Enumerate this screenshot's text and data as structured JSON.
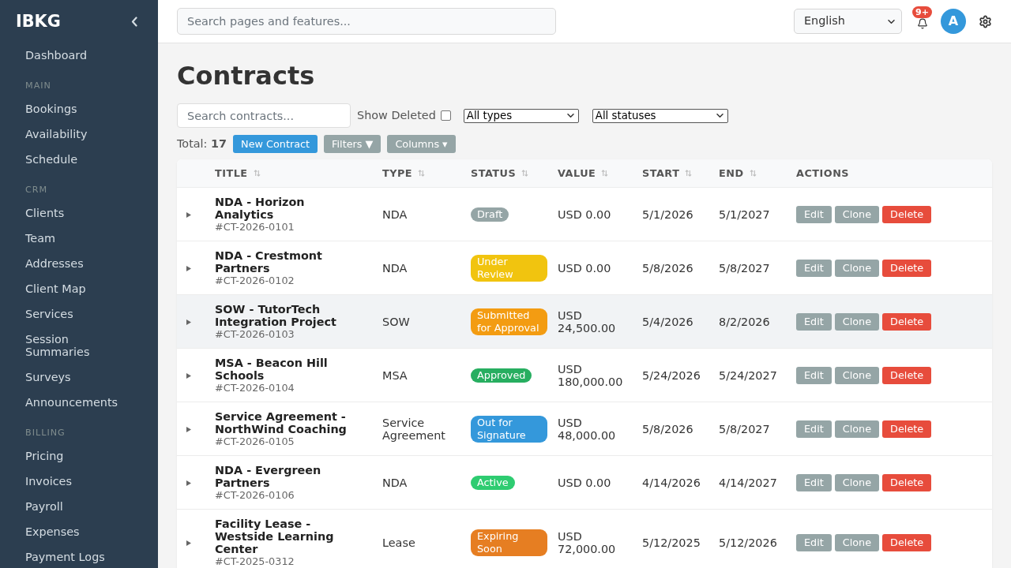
{
  "sidebar": {
    "brand": "IBKG",
    "sections": [
      {
        "items": [
          {
            "label": "Dashboard"
          }
        ]
      },
      {
        "heading": "MAIN",
        "items": [
          {
            "label": "Bookings"
          },
          {
            "label": "Availability"
          },
          {
            "label": "Schedule"
          }
        ]
      },
      {
        "heading": "CRM",
        "items": [
          {
            "label": "Clients"
          },
          {
            "label": "Team"
          },
          {
            "label": "Addresses"
          },
          {
            "label": "Client Map"
          },
          {
            "label": "Services"
          },
          {
            "label": "Session Summaries"
          },
          {
            "label": "Surveys"
          },
          {
            "label": "Announcements"
          }
        ]
      },
      {
        "heading": "BILLING",
        "items": [
          {
            "label": "Pricing"
          },
          {
            "label": "Invoices"
          },
          {
            "label": "Payroll"
          },
          {
            "label": "Expenses"
          },
          {
            "label": "Payment Logs"
          }
        ]
      }
    ]
  },
  "topbar": {
    "search": {
      "placeholder": "Search pages and features..."
    },
    "language": {
      "value": "English"
    },
    "notifications": {
      "badge": "9+"
    },
    "avatar": {
      "initial": "A"
    }
  },
  "page": {
    "title": "Contracts"
  },
  "filters": {
    "search": {
      "placeholder": "Search contracts..."
    },
    "show_deleted": {
      "label": "Show Deleted",
      "checked": false
    },
    "type_select": {
      "value": "All types"
    },
    "status_select": {
      "value": "All statuses"
    }
  },
  "toolbar": {
    "total": "Total: **17**",
    "buttons": [
      {
        "label": "New Contract",
        "kind": "primary"
      },
      {
        "label": "Filters ▼",
        "kind": "secondary"
      },
      {
        "label": "Columns ▾",
        "kind": "secondary"
      }
    ]
  },
  "table": {
    "columns": [
      {
        "label": "TITLE",
        "sortable": true
      },
      {
        "label": "TYPE",
        "sortable": true
      },
      {
        "label": "STATUS",
        "sortable": true
      },
      {
        "label": "VALUE",
        "sortable": true
      },
      {
        "label": "START",
        "sortable": true
      },
      {
        "label": "END",
        "sortable": true
      },
      {
        "label": "ACTIONS",
        "sortable": false
      }
    ],
    "rows": [
      {
        "title": "NDA - Horizon Analytics",
        "id": "#CT-2026-0101",
        "type": "NDA",
        "status": {
          "label": "Draft",
          "color": "#95a5a6"
        },
        "value": "USD 0.00",
        "start": "5/1/2026",
        "end": "5/1/2027",
        "highlighted": false,
        "actions": [
          {
            "label": "Edit",
            "kind": "secondary"
          },
          {
            "label": "Clone",
            "kind": "secondary"
          },
          {
            "label": "Delete",
            "kind": "danger"
          }
        ]
      },
      {
        "title": "NDA - Crestmont Partners",
        "id": "#CT-2026-0102",
        "type": "NDA",
        "status": {
          "label": "Under Review",
          "color": "#f1c40f"
        },
        "value": "USD 0.00",
        "start": "5/8/2026",
        "end": "5/8/2027",
        "highlighted": false,
        "actions": [
          {
            "label": "Edit",
            "kind": "secondary"
          },
          {
            "label": "Clone",
            "kind": "secondary"
          },
          {
            "label": "Delete",
            "kind": "danger"
          }
        ]
      },
      {
        "title": "SOW - TutorTech Integration Project",
        "id": "#CT-2026-0103",
        "type": "SOW",
        "status": {
          "label": "Submitted for Approval",
          "color": "#f39c12"
        },
        "value": "USD 24,500.00",
        "start": "5/4/2026",
        "end": "8/2/2026",
        "highlighted": true,
        "actions": [
          {
            "label": "Edit",
            "kind": "secondary"
          },
          {
            "label": "Clone",
            "kind": "secondary"
          },
          {
            "label": "Delete",
            "kind": "danger"
          }
        ]
      },
      {
        "title": "MSA - Beacon Hill Schools",
        "id": "#CT-2026-0104",
        "type": "MSA",
        "status": {
          "label": "Approved",
          "color": "#27ae60"
        },
        "value": "USD 180,000.00",
        "start": "5/24/2026",
        "end": "5/24/2027",
        "highlighted": false,
        "actions": [
          {
            "label": "Edit",
            "kind": "secondary"
          },
          {
            "label": "Clone",
            "kind": "secondary"
          },
          {
            "label": "Delete",
            "kind": "danger"
          }
        ]
      },
      {
        "title": "Service Agreement - NorthWind Coaching",
        "id": "#CT-2026-0105",
        "type": "Service Agreement",
        "status": {
          "label": "Out for Signature",
          "color": "#3498db"
        },
        "value": "USD 48,000.00",
        "start": "5/8/2026",
        "end": "5/8/2027",
        "highlighted": false,
        "actions": [
          {
            "label": "Edit",
            "kind": "secondary"
          },
          {
            "label": "Clone",
            "kind": "secondary"
          },
          {
            "label": "Delete",
            "kind": "danger"
          }
        ]
      },
      {
        "title": "NDA - Evergreen Partners",
        "id": "#CT-2026-0106",
        "type": "NDA",
        "status": {
          "label": "Active",
          "color": "#2ecc71"
        },
        "value": "USD 0.00",
        "start": "4/14/2026",
        "end": "4/14/2027",
        "highlighted": false,
        "actions": [
          {
            "label": "Edit",
            "kind": "secondary"
          },
          {
            "label": "Clone",
            "kind": "secondary"
          },
          {
            "label": "Delete",
            "kind": "danger"
          }
        ]
      },
      {
        "title": "Facility Lease - Westside Learning Center",
        "id": "#CT-2025-0312",
        "type": "Lease",
        "status": {
          "label": "Expiring Soon",
          "color": "#e67e22"
        },
        "value": "USD 72,000.00",
        "start": "5/12/2025",
        "end": "5/12/2026",
        "highlighted": false,
        "actions": [
          {
            "label": "Edit",
            "kind": "secondary"
          },
          {
            "label": "Clone",
            "kind": "secondary"
          },
          {
            "label": "Delete",
            "kind": "danger"
          }
        ]
      }
    ]
  }
}
